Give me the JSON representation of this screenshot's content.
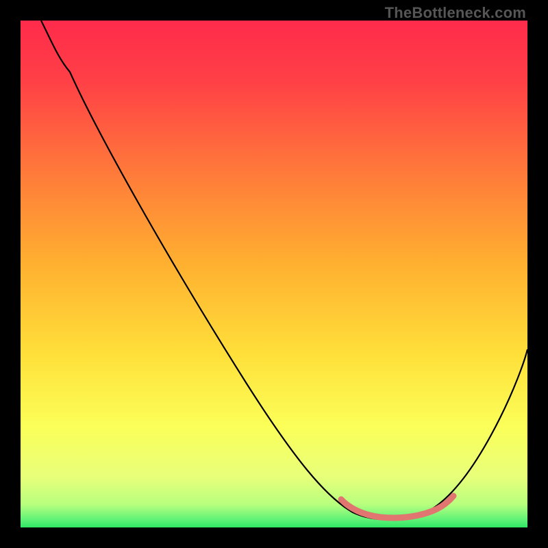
{
  "watermark": "TheBottleneck.com",
  "colors": {
    "gradient_top": "#ff2b4b",
    "gradient_mid1": "#ff5040",
    "gradient_mid2": "#ffa726",
    "gradient_mid3": "#ffe03a",
    "gradient_mid4": "#fdff66",
    "gradient_bottom": "#2fe663",
    "curve": "#000000",
    "marker": "#e0766f",
    "frame": "#000000"
  },
  "chart_data": {
    "type": "line",
    "title": "",
    "xlabel": "",
    "ylabel": "",
    "xlim": [
      0,
      100
    ],
    "ylim": [
      0,
      100
    ],
    "series": [
      {
        "name": "bottleneck-curve",
        "x": [
          4,
          6,
          10,
          20,
          30,
          40,
          50,
          60,
          65,
          70,
          75,
          80,
          85,
          90,
          95,
          100
        ],
        "y": [
          100,
          95,
          90,
          76,
          62,
          48,
          34,
          18,
          8,
          3,
          2,
          2,
          4,
          12,
          24,
          38
        ]
      },
      {
        "name": "optimal-range-marker",
        "x": [
          64,
          66,
          70,
          75,
          80,
          83,
          85
        ],
        "y": [
          6,
          4,
          2.5,
          2,
          2.2,
          3.5,
          5
        ]
      }
    ],
    "annotations": [
      {
        "text": "TheBottleneck.com",
        "position": "top-right"
      }
    ]
  }
}
